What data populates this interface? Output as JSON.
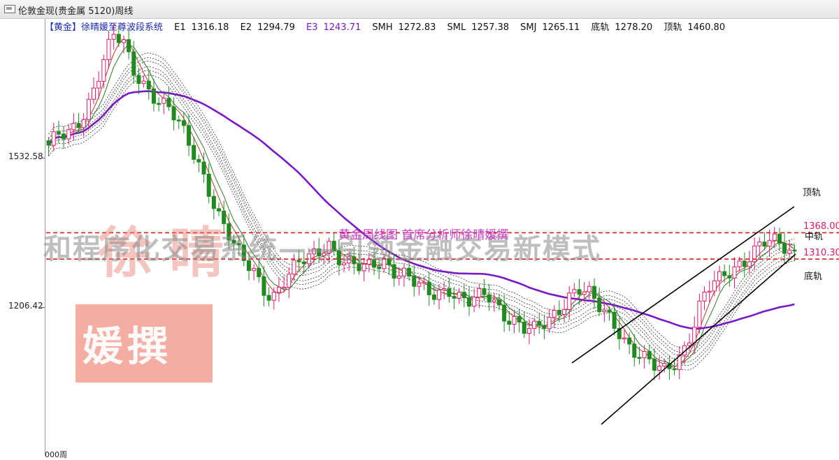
{
  "window": {
    "title": "伦敦金现(贵金属 5120)周线"
  },
  "info_bar": {
    "symbol": "【黄金】",
    "system": "徐晴媛至尊波段系统",
    "items": [
      {
        "label": "E1",
        "value": "1316.18"
      },
      {
        "label": "E2",
        "value": "1294.79"
      },
      {
        "label": "E3",
        "value": "1243.71"
      },
      {
        "label": "SMH",
        "value": "1272.83"
      },
      {
        "label": "SML",
        "value": "1257.38"
      },
      {
        "label": "SMJ",
        "value": "1265.11"
      },
      {
        "label": "底轨",
        "value": "1278.20"
      },
      {
        "label": "顶轨",
        "value": "1460.80"
      }
    ]
  },
  "y_axis": {
    "ticks": [
      "1532.58",
      "1206.42"
    ]
  },
  "watermarks": {
    "main": "和程序化交易系统——引领金融交易新模式",
    "caption": "黄金周线图  首席分析师徐晴媛撰",
    "box_text": "媛撰",
    "faint": "徐晴"
  },
  "levels": {
    "upper_price": "1368.00",
    "lower_price": "1310.30",
    "top_rail": "顶轨",
    "mid_rail": "中轨",
    "bottom_rail": "底轨"
  },
  "bottom_label": "000周",
  "colors": {
    "up": "#e0186a",
    "down": "#1f8a1f",
    "ma_long": "#7a18c8",
    "level_line": "#d81e1e",
    "neutral": "#3060e0"
  },
  "chart_data": {
    "type": "candlestick",
    "timeframe": "weekly",
    "ylim": [
      1050,
      1800
    ],
    "yticks": [
      1206.42,
      1532.58
    ],
    "horizontal_levels": [
      1368.0,
      1310.3
    ],
    "bars": 150,
    "close_path": [
      1560,
      1580,
      1575,
      1600,
      1640,
      1700,
      1760,
      1800,
      1780,
      1720,
      1700,
      1680,
      1660,
      1640,
      1600,
      1560,
      1520,
      1480,
      1420,
      1380,
      1330,
      1300,
      1280,
      1250,
      1230,
      1260,
      1280,
      1300,
      1310,
      1330,
      1350,
      1320,
      1300,
      1290,
      1285,
      1300,
      1310,
      1290,
      1280,
      1260,
      1240,
      1230,
      1240,
      1250,
      1230,
      1215,
      1220,
      1230,
      1210,
      1190,
      1180,
      1160,
      1150,
      1160,
      1180,
      1210,
      1240,
      1250,
      1230,
      1200,
      1180,
      1160,
      1130,
      1110,
      1090,
      1070,
      1060,
      1080,
      1110,
      1160,
      1220,
      1250,
      1260,
      1280,
      1300,
      1320,
      1340,
      1350,
      1340,
      1330,
      1320
    ]
  }
}
